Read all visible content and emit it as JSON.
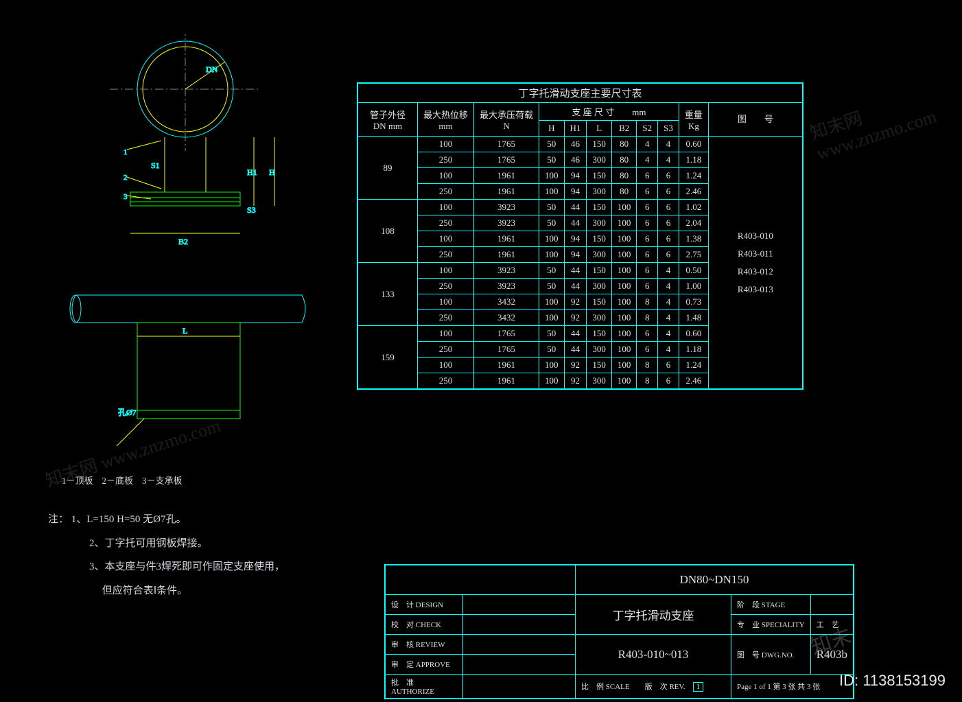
{
  "watermark": "知末网 www.znzmo.com",
  "id_tag": "ID: 1138153199",
  "diagram": {
    "labels": {
      "dn": "DN",
      "s1": "S1",
      "h1": "H1",
      "h": "H",
      "b2": "B2",
      "s3": "S3",
      "l": "L",
      "hole": "孔Ø7",
      "p1": "1",
      "p2": "2",
      "p3": "3"
    }
  },
  "legend": "1－顶板　2－底板　3－支承板",
  "notes_label": "注：",
  "notes": [
    "1、L=150  H=50  无Ø7孔。",
    "2、丁字托可用钢板焊接。",
    "3、本支座与件3焊死即可作固定支座使用，",
    "　 但应符合表Ⅰ条件。"
  ],
  "table": {
    "title": "丁字托滑动支座主要尺寸表",
    "head1": {
      "c1": "管子外径",
      "c2": "最大热位移",
      "c3": "最大承压荷载",
      "c4": "支 座 尺 寸　　mm",
      "c5": "重量",
      "c6": "图　　号"
    },
    "head2": {
      "c1": "DN mm",
      "c2": "mm",
      "c3": "N",
      "h": "H",
      "h1": "H1",
      "l": "L",
      "b2": "B2",
      "s2": "S2",
      "s3": "S3",
      "kg": "Kg"
    },
    "ref_list": [
      "R403-010",
      "R403-011",
      "R403-012",
      "R403-013"
    ],
    "groups": [
      {
        "dn": "89",
        "rows": [
          [
            "100",
            "1765",
            "50",
            "46",
            "150",
            "80",
            "4",
            "4",
            "0.60"
          ],
          [
            "250",
            "1765",
            "50",
            "46",
            "300",
            "80",
            "4",
            "4",
            "1.18"
          ],
          [
            "100",
            "1961",
            "100",
            "94",
            "150",
            "80",
            "6",
            "6",
            "1.24"
          ],
          [
            "250",
            "1961",
            "100",
            "94",
            "300",
            "80",
            "6",
            "6",
            "2.46"
          ]
        ]
      },
      {
        "dn": "108",
        "rows": [
          [
            "100",
            "3923",
            "50",
            "44",
            "150",
            "100",
            "6",
            "6",
            "1.02"
          ],
          [
            "250",
            "3923",
            "50",
            "44",
            "300",
            "100",
            "6",
            "6",
            "2.04"
          ],
          [
            "100",
            "1961",
            "100",
            "94",
            "150",
            "100",
            "6",
            "6",
            "1.38"
          ],
          [
            "250",
            "1961",
            "100",
            "94",
            "300",
            "100",
            "6",
            "6",
            "2.75"
          ]
        ]
      },
      {
        "dn": "133",
        "rows": [
          [
            "100",
            "3923",
            "50",
            "44",
            "150",
            "100",
            "6",
            "4",
            "0.50"
          ],
          [
            "250",
            "3923",
            "50",
            "44",
            "300",
            "100",
            "6",
            "4",
            "1.00"
          ],
          [
            "100",
            "3432",
            "100",
            "92",
            "150",
            "100",
            "8",
            "4",
            "0.73"
          ],
          [
            "250",
            "3432",
            "100",
            "92",
            "300",
            "100",
            "8",
            "4",
            "1.48"
          ]
        ]
      },
      {
        "dn": "159",
        "rows": [
          [
            "100",
            "1765",
            "50",
            "44",
            "150",
            "100",
            "6",
            "4",
            "0.60"
          ],
          [
            "250",
            "1765",
            "50",
            "44",
            "300",
            "100",
            "6",
            "4",
            "1.18"
          ],
          [
            "100",
            "1961",
            "100",
            "92",
            "150",
            "100",
            "8",
            "6",
            "1.24"
          ],
          [
            "250",
            "1961",
            "100",
            "92",
            "300",
            "100",
            "8",
            "6",
            "2.46"
          ]
        ]
      }
    ]
  },
  "titleblock": {
    "range": "DN80~DN150",
    "name": "丁字托滑动支座",
    "code": "R403-010~013",
    "sheet": "R403b",
    "labels": {
      "design": "设　计\nDESIGN",
      "check": "校　对\nCHECK",
      "review": "审　核\nREVIEW",
      "approve": "审　定\nAPPROVE",
      "authorize": "批　准\nAUTHORIZE",
      "scale": "比　例\nSCALE",
      "rev": "版　次\nREV.",
      "stage": "阶　段\nSTAGE",
      "spec": "专　业\nSPECIALITY",
      "spec_v": "工　艺",
      "dwg": "图　号\nDWG.NO.",
      "page": "Page 1 of 1  第 3 张  共 3 张"
    },
    "rev_mark": "1"
  }
}
